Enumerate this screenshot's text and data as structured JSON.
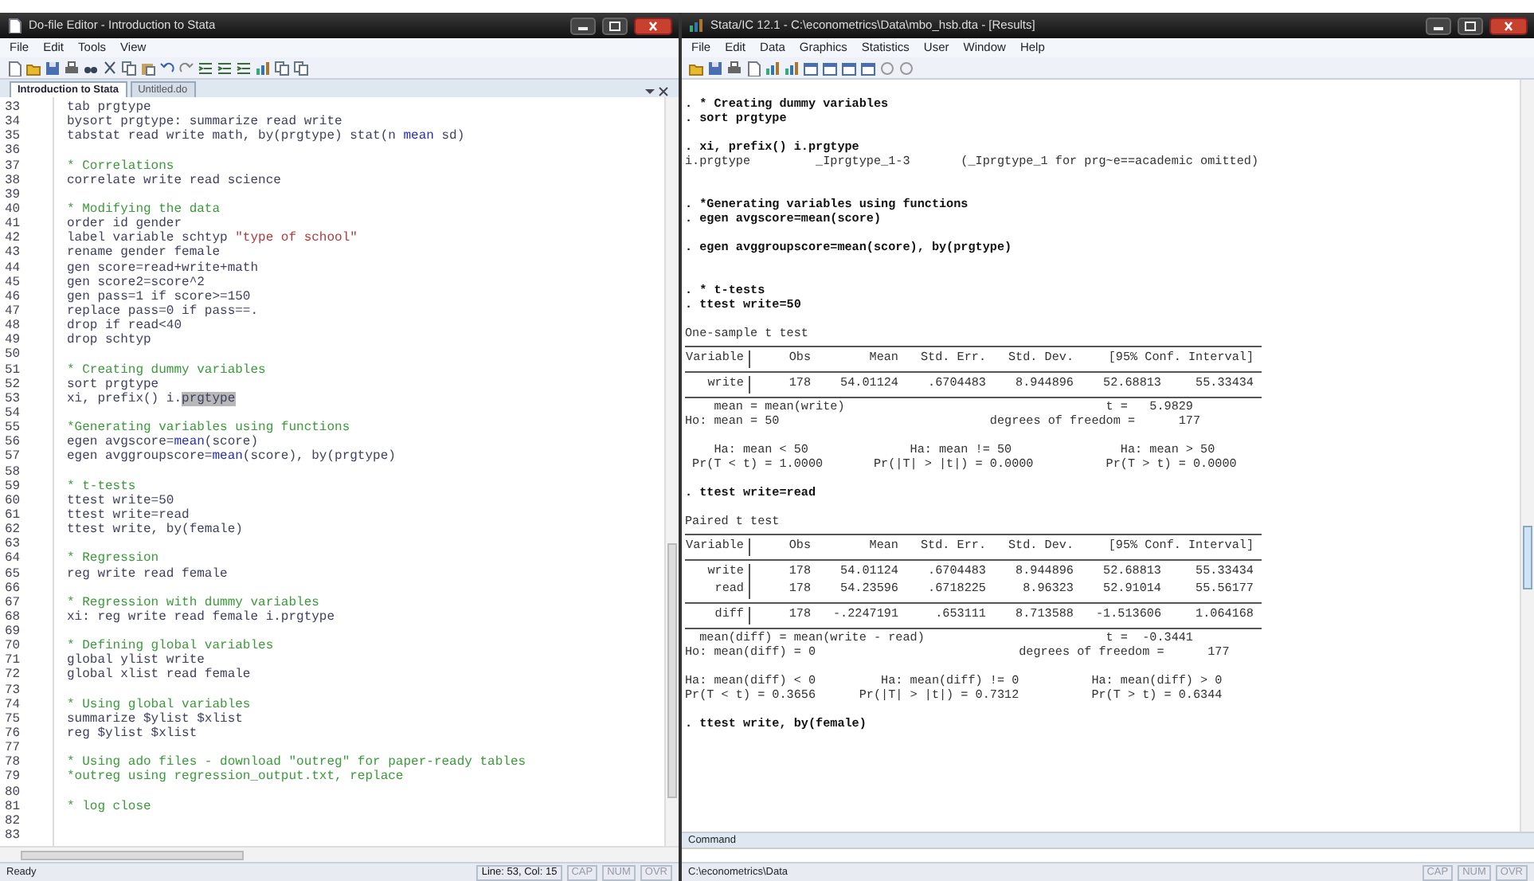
{
  "editor": {
    "title": "Do-file Editor - Introduction to Stata",
    "menu": [
      "File",
      "Edit",
      "Tools",
      "View"
    ],
    "tabs": [
      {
        "label": "Introduction to Stata",
        "selected": true
      },
      {
        "label": "Untitled.do",
        "selected": false
      }
    ],
    "lines": [
      {
        "n": "33",
        "parts": [
          {
            "t": "tab prgtype",
            "kind": "code"
          }
        ]
      },
      {
        "n": "34",
        "parts": [
          {
            "t": "bysort prgtype: summarize read write",
            "kind": "code"
          }
        ]
      },
      {
        "n": "35",
        "parts": [
          {
            "t": "tabstat read write math, by(prgtype) stat(n ",
            "kind": "code"
          },
          {
            "t": "mean",
            "kind": "func"
          },
          {
            "t": " sd)",
            "kind": "code"
          }
        ]
      },
      {
        "n": "36"
      },
      {
        "n": "37",
        "parts": [
          {
            "t": "* Correlations",
            "kind": "comment"
          }
        ]
      },
      {
        "n": "38",
        "parts": [
          {
            "t": "correlate write read science",
            "kind": "code"
          }
        ]
      },
      {
        "n": "39"
      },
      {
        "n": "40",
        "parts": [
          {
            "t": "* Modifying the data",
            "kind": "comment"
          }
        ]
      },
      {
        "n": "41",
        "parts": [
          {
            "t": "order id gender",
            "kind": "code"
          }
        ]
      },
      {
        "n": "42",
        "parts": [
          {
            "t": "label variable schtyp ",
            "kind": "code"
          },
          {
            "t": "\"type of school\"",
            "kind": "string"
          }
        ]
      },
      {
        "n": "43",
        "parts": [
          {
            "t": "rename gender female",
            "kind": "code"
          }
        ]
      },
      {
        "n": "44",
        "parts": [
          {
            "t": "gen score=read+write+math",
            "kind": "code"
          }
        ]
      },
      {
        "n": "45",
        "parts": [
          {
            "t": "gen score2=score^2",
            "kind": "code"
          }
        ]
      },
      {
        "n": "46",
        "parts": [
          {
            "t": "gen pass=1 if score>=150",
            "kind": "code"
          }
        ]
      },
      {
        "n": "47",
        "parts": [
          {
            "t": "replace pass=0 if pass==.",
            "kind": "code"
          }
        ]
      },
      {
        "n": "48",
        "parts": [
          {
            "t": "drop if read<40",
            "kind": "code"
          }
        ]
      },
      {
        "n": "49",
        "parts": [
          {
            "t": "drop schtyp",
            "kind": "code"
          }
        ]
      },
      {
        "n": "50"
      },
      {
        "n": "51",
        "parts": [
          {
            "t": "* Creating dummy variables",
            "kind": "comment"
          }
        ]
      },
      {
        "n": "52",
        "parts": [
          {
            "t": "sort prgtype",
            "kind": "code"
          }
        ]
      },
      {
        "n": "53",
        "parts": [
          {
            "t": "xi, prefix() i.",
            "kind": "code"
          },
          {
            "t": "prgtype",
            "kind": "selected"
          }
        ]
      },
      {
        "n": "54"
      },
      {
        "n": "55",
        "parts": [
          {
            "t": "*Generating variables using functions",
            "kind": "comment"
          }
        ]
      },
      {
        "n": "56",
        "parts": [
          {
            "t": "egen avgscore=",
            "kind": "code"
          },
          {
            "t": "mean",
            "kind": "func"
          },
          {
            "t": "(score)",
            "kind": "code"
          }
        ]
      },
      {
        "n": "57",
        "parts": [
          {
            "t": "egen avggroupscore=",
            "kind": "code"
          },
          {
            "t": "mean",
            "kind": "func"
          },
          {
            "t": "(score), by(prgtype)",
            "kind": "code"
          }
        ]
      },
      {
        "n": "58"
      },
      {
        "n": "59",
        "parts": [
          {
            "t": "* t-tests",
            "kind": "comment"
          }
        ]
      },
      {
        "n": "60",
        "parts": [
          {
            "t": "ttest write=50",
            "kind": "code"
          }
        ]
      },
      {
        "n": "61",
        "parts": [
          {
            "t": "ttest write=read",
            "kind": "code"
          }
        ]
      },
      {
        "n": "62",
        "parts": [
          {
            "t": "ttest write, by(female)",
            "kind": "code"
          }
        ]
      },
      {
        "n": "63"
      },
      {
        "n": "64",
        "parts": [
          {
            "t": "* Regression",
            "kind": "comment"
          }
        ]
      },
      {
        "n": "65",
        "parts": [
          {
            "t": "reg write read female",
            "kind": "code"
          }
        ]
      },
      {
        "n": "66"
      },
      {
        "n": "67",
        "parts": [
          {
            "t": "* Regression with dummy variables",
            "kind": "comment"
          }
        ]
      },
      {
        "n": "68",
        "parts": [
          {
            "t": "xi: reg write read female i.prgtype",
            "kind": "code"
          }
        ]
      },
      {
        "n": "69"
      },
      {
        "n": "70",
        "parts": [
          {
            "t": "* Defining global variables",
            "kind": "comment"
          }
        ]
      },
      {
        "n": "71",
        "parts": [
          {
            "t": "global ylist write",
            "kind": "code"
          }
        ]
      },
      {
        "n": "72",
        "parts": [
          {
            "t": "global xlist read female",
            "kind": "code"
          }
        ]
      },
      {
        "n": "73"
      },
      {
        "n": "74",
        "parts": [
          {
            "t": "* Using global variables",
            "kind": "comment"
          }
        ]
      },
      {
        "n": "75",
        "parts": [
          {
            "t": "summarize $ylist $xlist",
            "kind": "code"
          }
        ]
      },
      {
        "n": "76",
        "parts": [
          {
            "t": "reg $ylist $xlist",
            "kind": "code"
          }
        ]
      },
      {
        "n": "77"
      },
      {
        "n": "78",
        "parts": [
          {
            "t": "* Using ado files - download \"outreg\" for paper-ready tables",
            "kind": "comment"
          }
        ]
      },
      {
        "n": "79",
        "parts": [
          {
            "t": "*outreg using regression_output.txt, replace",
            "kind": "comment"
          }
        ]
      },
      {
        "n": "80"
      },
      {
        "n": "81",
        "parts": [
          {
            "t": "* log close",
            "kind": "comment"
          }
        ]
      },
      {
        "n": "82"
      },
      {
        "n": "83"
      }
    ],
    "status": {
      "text": "Ready",
      "position": "Line: 53, Col: 15",
      "indicators": [
        {
          "label": "CAP",
          "on": false
        },
        {
          "label": "NUM",
          "on": false
        },
        {
          "label": "OVR",
          "on": false
        }
      ]
    }
  },
  "stata": {
    "title": "Stata/IC 12.1 - C:\\econometrics\\Data\\mbo_hsb.dta - [Results]",
    "menu": [
      "File",
      "Edit",
      "Data",
      "Graphics",
      "Statistics",
      "User",
      "Window",
      "Help"
    ],
    "results": [
      {
        "kind": "blank"
      },
      {
        "kind": "cmd",
        "text": ". * Creating dummy variables"
      },
      {
        "kind": "cmd",
        "text": ". sort prgtype"
      },
      {
        "kind": "blank"
      },
      {
        "kind": "cmd",
        "text": ". xi, prefix() i.prgtype"
      },
      {
        "kind": "text",
        "text": "i.prgtype         _Iprgtype_1-3       (_Iprgtype_1 for prg~e==academic omitted)"
      },
      {
        "kind": "blank"
      },
      {
        "kind": "blank"
      },
      {
        "kind": "cmd",
        "text": ". *Generating variables using functions"
      },
      {
        "kind": "cmd",
        "text": ". egen avgscore=mean(score)"
      },
      {
        "kind": "blank"
      },
      {
        "kind": "cmd",
        "text": ". egen avggroupscore=mean(score), by(prgtype)"
      },
      {
        "kind": "blank"
      },
      {
        "kind": "blank"
      },
      {
        "kind": "cmd",
        "text": ". * t-tests"
      },
      {
        "kind": "cmd",
        "text": ". ttest write=50"
      },
      {
        "kind": "blank"
      },
      {
        "kind": "text",
        "text": "One-sample t test"
      },
      {
        "kind": "rule"
      },
      {
        "kind": "header",
        "cells": [
          "Variable",
          "Obs",
          "Mean",
          "Std. Err.",
          "Std. Dev.",
          "[95% Conf. Interval]"
        ]
      },
      {
        "kind": "rule"
      },
      {
        "kind": "row",
        "cells": [
          "write",
          "178",
          "54.01124",
          ".6704483",
          "8.944896",
          "52.68813",
          "55.33434"
        ]
      },
      {
        "kind": "rule"
      },
      {
        "kind": "text",
        "text": "    mean = mean(write)                                    t =   5.9829"
      },
      {
        "kind": "text",
        "text": "Ho: mean = 50                             degrees of freedom =      177"
      },
      {
        "kind": "blank"
      },
      {
        "kind": "text",
        "text": "    Ha: mean < 50              Ha: mean != 50               Ha: mean > 50"
      },
      {
        "kind": "text",
        "text": " Pr(T < t) = 1.0000       Pr(|T| > |t|) = 0.0000          Pr(T > t) = 0.0000"
      },
      {
        "kind": "blank"
      },
      {
        "kind": "cmd",
        "text": ". ttest write=read"
      },
      {
        "kind": "blank"
      },
      {
        "kind": "text",
        "text": "Paired t test"
      },
      {
        "kind": "rule"
      },
      {
        "kind": "header",
        "cells": [
          "Variable",
          "Obs",
          "Mean",
          "Std. Err.",
          "Std. Dev.",
          "[95% Conf. Interval]"
        ]
      },
      {
        "kind": "rule"
      },
      {
        "kind": "row",
        "cells": [
          "write",
          "178",
          "54.01124",
          ".6704483",
          "8.944896",
          "52.68813",
          "55.33434"
        ]
      },
      {
        "kind": "row",
        "cells": [
          "read",
          "178",
          "54.23596",
          ".6718225",
          "8.96323",
          "52.91014",
          "55.56177"
        ]
      },
      {
        "kind": "rule"
      },
      {
        "kind": "row",
        "cells": [
          "diff",
          "178",
          "-.2247191",
          ".653111",
          "8.713588",
          "-1.513606",
          "1.064168"
        ]
      },
      {
        "kind": "rule"
      },
      {
        "kind": "text",
        "text": "  mean(diff) = mean(write - read)                         t =  -0.3441"
      },
      {
        "kind": "text",
        "text": "Ho: mean(diff) = 0                            degrees of freedom =      177"
      },
      {
        "kind": "blank"
      },
      {
        "kind": "text",
        "text": "Ha: mean(diff) < 0         Ha: mean(diff) != 0          Ha: mean(diff) > 0"
      },
      {
        "kind": "text",
        "text": "Pr(T < t) = 0.3656      Pr(|T| > |t|) = 0.7312          Pr(T > t) = 0.6344"
      },
      {
        "kind": "blank"
      },
      {
        "kind": "cmd",
        "text": ". ttest write, by(female)"
      }
    ],
    "command_label": "Command",
    "status": {
      "text": "C:\\econometrics\\Data",
      "indicators": [
        {
          "label": "CAP",
          "on": false
        },
        {
          "label": "NUM",
          "on": false
        },
        {
          "label": "OVR",
          "on": false
        }
      ]
    }
  }
}
